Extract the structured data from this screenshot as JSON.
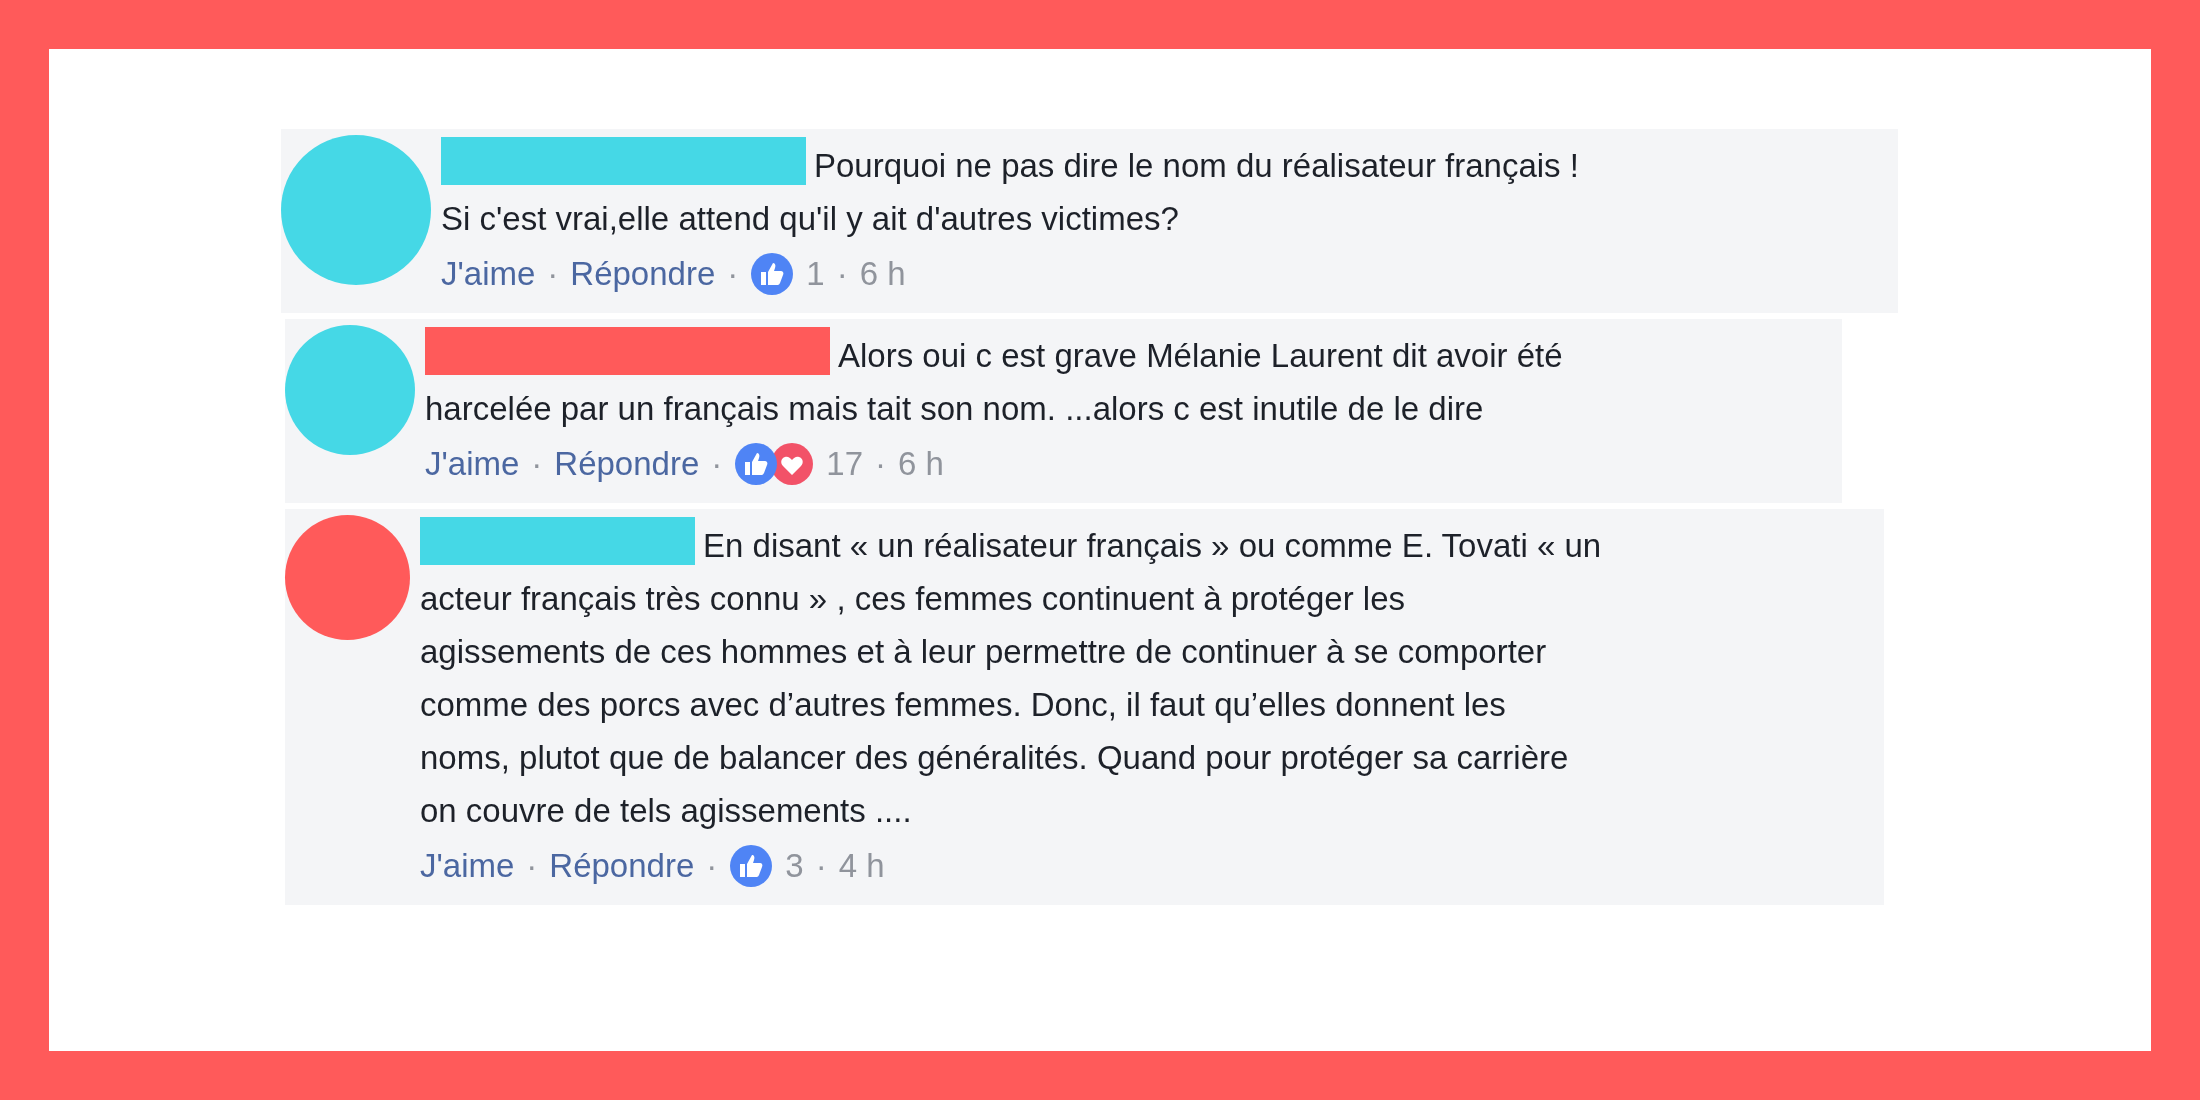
{
  "comments": [
    {
      "avatar": {
        "color": "#45d8e6"
      },
      "name_bar": {
        "color": "#45d8e6"
      },
      "text": "Pourquoi ne pas dire le nom du réalisateur français !\nSi c'est vrai,elle attend qu'il y ait d'autres victimes?",
      "meta": [
        {
          "kind": "link",
          "text": "J'aime"
        },
        {
          "kind": "sep",
          "text": "·"
        },
        {
          "kind": "link",
          "text": "Répondre"
        },
        {
          "kind": "sep",
          "text": "·"
        },
        {
          "kind": "reactions",
          "items": [
            {
              "kind": "like"
            }
          ]
        },
        {
          "kind": "count",
          "text": "1"
        },
        {
          "kind": "sep",
          "text": "·"
        },
        {
          "kind": "time",
          "text": "6 h"
        }
      ]
    },
    {
      "avatar": {
        "color": "#45d8e6"
      },
      "name_bar": {
        "color": "#ff5a5a"
      },
      "text": "Alors oui c est grave Mélanie Laurent dit avoir été\nharcelée par un français mais tait son nom. ...alors c est inutile de le dire",
      "meta": [
        {
          "kind": "link",
          "text": "J'aime"
        },
        {
          "kind": "sep",
          "text": "·"
        },
        {
          "kind": "link",
          "text": "Répondre"
        },
        {
          "kind": "sep",
          "text": "·"
        },
        {
          "kind": "reactions",
          "items": [
            {
              "kind": "like"
            },
            {
              "kind": "love"
            }
          ]
        },
        {
          "kind": "count",
          "text": "17"
        },
        {
          "kind": "sep",
          "text": "·"
        },
        {
          "kind": "time",
          "text": "6 h"
        }
      ]
    },
    {
      "avatar": {
        "color": "#ff5a5a"
      },
      "name_bar": {
        "color": "#45d8e6"
      },
      "text": "En disant « un réalisateur français » ou comme E. Tovati « un\nacteur français très connu » , ces femmes continuent à protéger les\nagissements de ces hommes et à leur permettre de continuer à se comporter\ncomme des porcs avec d’autres femmes. Donc, il faut qu’elles donnent les\nnoms, plutot que de balancer des généralités. Quand pour protéger sa carrière\non couvre de tels agissements ....",
      "meta": [
        {
          "kind": "link",
          "text": "J'aime"
        },
        {
          "kind": "sep",
          "text": "·"
        },
        {
          "kind": "link",
          "text": "Répondre"
        },
        {
          "kind": "sep",
          "text": "·"
        },
        {
          "kind": "reactions",
          "items": [
            {
              "kind": "like"
            }
          ]
        },
        {
          "kind": "count",
          "text": "3"
        },
        {
          "kind": "sep",
          "text": "·"
        },
        {
          "kind": "time",
          "text": "4 h"
        }
      ]
    }
  ]
}
